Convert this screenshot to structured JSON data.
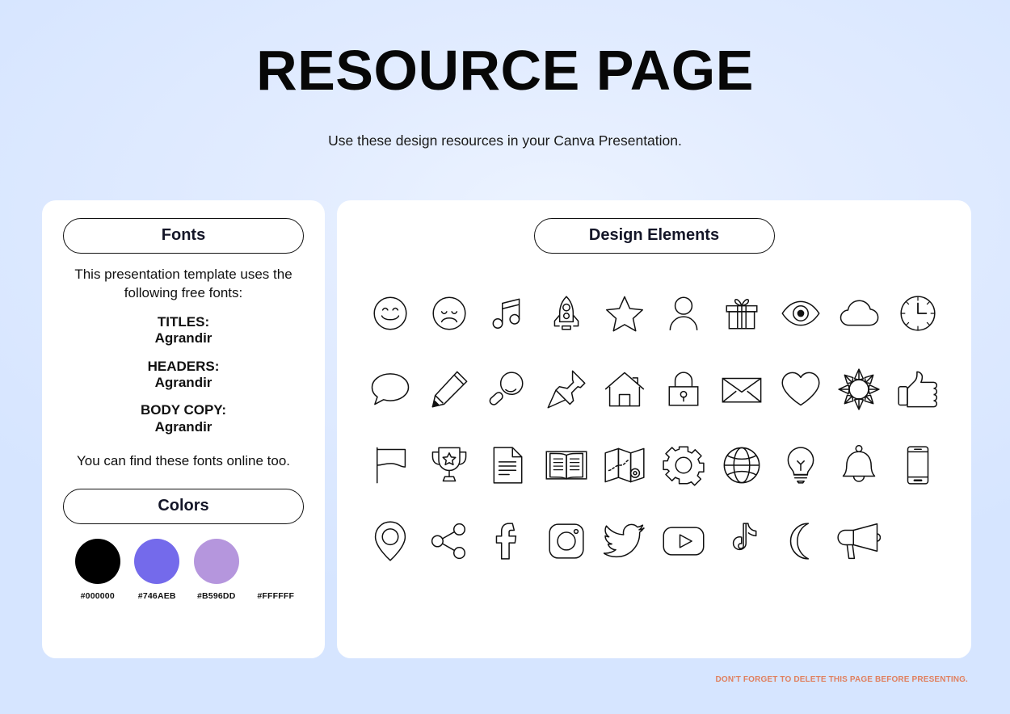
{
  "header": {
    "title": "RESOURCE PAGE",
    "subtitle": "Use these design resources in your Canva Presentation."
  },
  "fonts_panel": {
    "heading": "Fonts",
    "intro": "This presentation template uses the following free fonts:",
    "groups": [
      {
        "role": "TITLES:",
        "name": "Agrandir"
      },
      {
        "role": "HEADERS:",
        "name": "Agrandir"
      },
      {
        "role": "BODY COPY:",
        "name": "Agrandir"
      }
    ],
    "outro": "You can find these fonts online too."
  },
  "colors_panel": {
    "heading": "Colors",
    "swatches": [
      {
        "hex_label": "#000000",
        "color": "#000000"
      },
      {
        "hex_label": "#746AEB",
        "color": "#746AEB"
      },
      {
        "hex_label": "#B596DD",
        "color": "#B596DD"
      },
      {
        "hex_label": "#FFFFFF",
        "color": "#FFFFFF"
      }
    ]
  },
  "elements_panel": {
    "heading": "Design Elements",
    "icons": [
      "smiley-face-icon",
      "sad-face-icon",
      "music-note-icon",
      "rocket-icon",
      "star-icon",
      "person-icon",
      "gift-icon",
      "eye-icon",
      "cloud-icon",
      "clock-icon",
      "speech-bubble-icon",
      "pencil-icon",
      "magnifier-icon",
      "push-pin-icon",
      "house-icon",
      "lock-icon",
      "envelope-icon",
      "heart-icon",
      "sun-icon",
      "thumbs-up-icon",
      "flag-icon",
      "trophy-icon",
      "document-icon",
      "open-book-icon",
      "map-icon",
      "gear-icon",
      "globe-icon",
      "lightbulb-icon",
      "bell-icon",
      "phone-icon",
      "location-pin-icon",
      "share-icon",
      "facebook-icon",
      "instagram-icon",
      "twitter-icon",
      "youtube-icon",
      "tiktok-icon",
      "moon-icon",
      "megaphone-icon"
    ]
  },
  "footer": {
    "note": "DON'T FORGET TO DELETE THIS PAGE BEFORE PRESENTING.",
    "note_color": "#e08060"
  }
}
